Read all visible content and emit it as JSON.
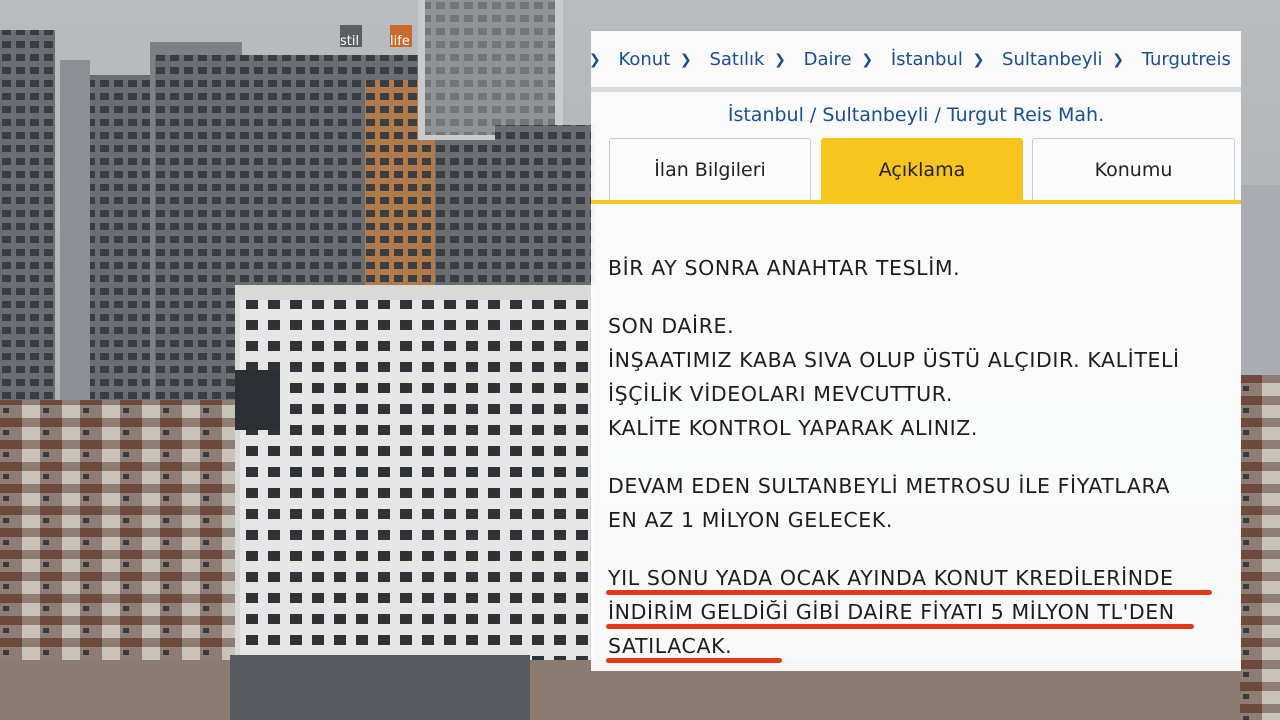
{
  "breadcrumb": {
    "items": [
      "Konut",
      "Satılık",
      "Daire",
      "İstanbul",
      "Sultanbeyli",
      "Turgutreis"
    ]
  },
  "location": "İstanbul / Sultanbeyli / Turgut Reis Mah.",
  "tabs": [
    {
      "label": "İlan Bilgileri",
      "active": false
    },
    {
      "label": "Açıklama",
      "active": true
    },
    {
      "label": "Konumu",
      "active": false
    }
  ],
  "description": {
    "p1": [
      "BİR AY SONRA ANAHTAR TESLİM."
    ],
    "p2": [
      "SON DAİRE.",
      "İNŞAATIMIZ KABA SIVA OLUP ÜSTÜ ALÇIDIR. KALİTELİ",
      "İŞÇİLİK VİDEOLARI MEVCUTTUR.",
      "KALİTE KONTROL YAPARAK ALINIZ."
    ],
    "p3": [
      "DEVAM EDEN SULTANBEYLİ METROSU İLE FİYATLARA",
      "EN AZ 1 MİLYON GELECEK."
    ],
    "p4": [
      "YIL SONU YADA OCAK AYINDA KONUT KREDİLERİNDE",
      "İNDİRİM GELDİĞİ GİBİ DAİRE FİYATI 5 MİLYON TL'DEN",
      "SATILACAK."
    ]
  },
  "colors": {
    "accent": "#f7c51e",
    "link": "#1b4d8f",
    "highlight_underline": "#e53817"
  },
  "icons": {
    "breadcrumb_separator": "chevron-right-icon"
  },
  "background": {
    "building_signs": [
      "stil",
      "life"
    ]
  }
}
